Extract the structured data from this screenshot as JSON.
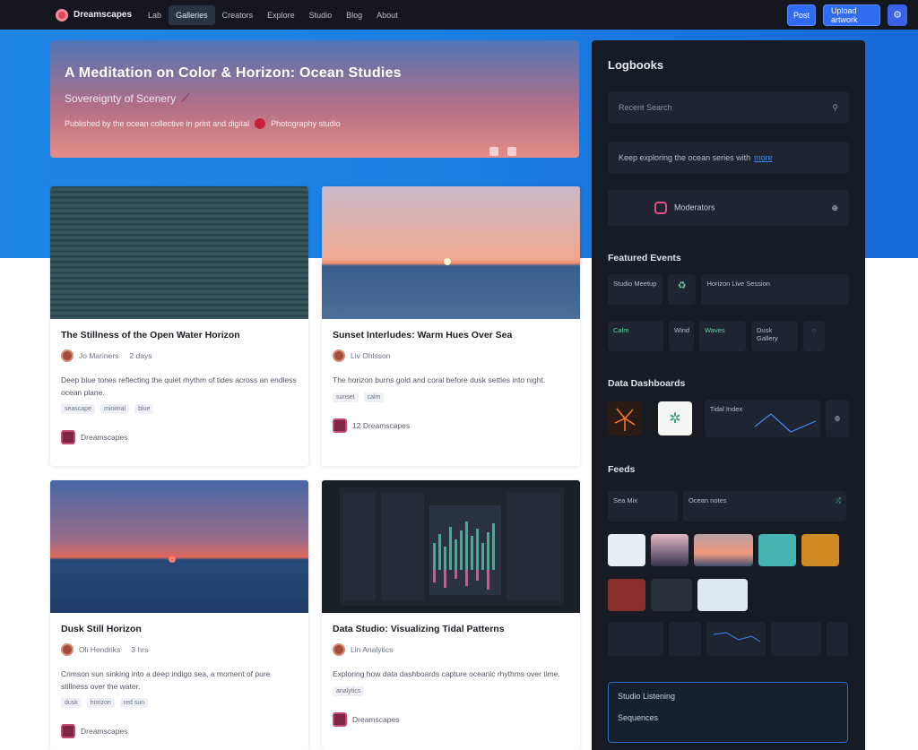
{
  "nav": {
    "brand": "Dreamscapes",
    "links": [
      "Lab",
      "Galleries",
      "Creators",
      "Explore",
      "Studio",
      "Blog",
      "About"
    ],
    "active_index": 1,
    "btn_primary": "Post",
    "btn_secondary": "Upload artwork"
  },
  "hero": {
    "title": "A Meditation on Color & Horizon: Ocean Studies",
    "subtitle": "Sovereignty of Scenery",
    "meta": "Published by the ocean collective in print and digital",
    "author": "Photography studio"
  },
  "cards": [
    {
      "title": "The Stillness of the Open Water Horizon",
      "author": "Jo Mariners",
      "time": "2 days",
      "text": "Deep blue tones reflecting the quiet rhythm of tides across an endless ocean plane.",
      "tags": [
        "seascape",
        "minimal",
        "blue"
      ],
      "footer": "Dreamscapes"
    },
    {
      "title": "Sunset Interludes: Warm Hues Over Sea",
      "author": "Liv Ohlsson",
      "time": "",
      "text": "The horizon burns gold and coral before dusk settles into night.",
      "tags": [
        "sunset",
        "calm"
      ],
      "footer": "12 Dreamscapes"
    },
    {
      "title": "Dusk Still Horizon",
      "author": "Oli Hendriks",
      "time": "3 hrs",
      "text": "Crimson sun sinking into a deep indigo sea, a moment of pure stillness over the water.",
      "tags": [
        "dusk",
        "horizon",
        "red sun"
      ],
      "footer": "Dreamscapes"
    },
    {
      "title": "Data Studio: Visualizing Tidal Patterns",
      "author": "Lin Analytics",
      "time": "",
      "text": "Exploring how data dashboards capture oceanic rhythms over time.",
      "tags": [
        "analytics"
      ],
      "footer": "Dreamscapes"
    }
  ],
  "sidebar": {
    "title": "Logbooks",
    "search_placeholder": "Recent Search",
    "promo_text": "Keep exploring the ocean series with",
    "promo_link": "more",
    "profile": "Moderators",
    "featured_title": "Featured Events",
    "featured_tiles": [
      "Studio Meetup",
      "Horizon Live Session",
      "Calm",
      "Wind",
      "Waves",
      "Dusk Gallery"
    ],
    "dashboard_title": "Data Dashboards",
    "dash_tile": "Tidal Index",
    "feeds_title": "Feeds",
    "feed_a": "Sea Mix",
    "feed_b": "Ocean notes",
    "panel_line1": "Studio Listening",
    "panel_line2": "Sequences"
  },
  "colors": {
    "accent": "#2f6cf2",
    "nav_bg": "#14171d",
    "sidebar_bg": "#161b24",
    "hero_top": "#4f75b7",
    "hero_bottom": "#e58d86"
  }
}
